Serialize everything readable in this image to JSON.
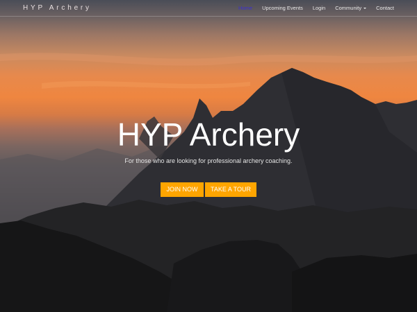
{
  "brand": "HYP Archery",
  "nav": {
    "home": "Home",
    "events": "Upcoming Events",
    "login": "Login",
    "community": "Community",
    "contact": "Contact"
  },
  "hero": {
    "title": "HYP Archery",
    "tagline": "For those who are looking for professional archery coaching.",
    "join_label": "JOIN NOW",
    "tour_label": "TAKE A TOUR"
  },
  "colors": {
    "accent": "#ffa500",
    "nav_active": "#3b2fd1",
    "text": "#ffffff"
  },
  "icons": {
    "dropdown": "chevron-down-icon"
  }
}
